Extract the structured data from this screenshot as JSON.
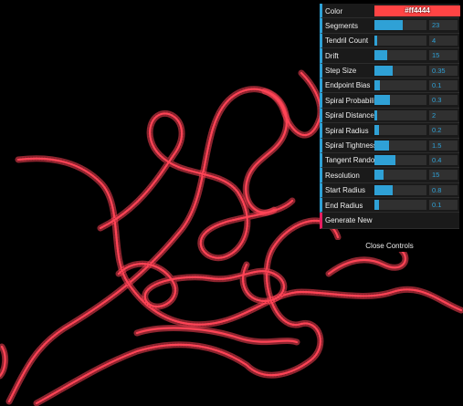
{
  "gui": {
    "color": {
      "label": "Color",
      "value": "#ff4444"
    },
    "sliders": [
      {
        "label": "Segments",
        "value": "23",
        "fill": 0.55
      },
      {
        "label": "Tendril Count",
        "value": "4",
        "fill": 0.06
      },
      {
        "label": "Drift",
        "value": "15",
        "fill": 0.24
      },
      {
        "label": "Step Size",
        "value": "0.35",
        "fill": 0.35
      },
      {
        "label": "Endpoint Bias",
        "value": "0.1",
        "fill": 0.1
      },
      {
        "label": "Spiral Probability",
        "value": "0.3",
        "fill": 0.3
      },
      {
        "label": "Spiral Distance",
        "value": "2",
        "fill": 0.05
      },
      {
        "label": "Spiral Radius",
        "value": "0.2",
        "fill": 0.08
      },
      {
        "label": "Spiral Tightness",
        "value": "1.5",
        "fill": 0.28
      },
      {
        "label": "Tangent Random",
        "value": "0.4",
        "fill": 0.4
      },
      {
        "label": "Resolution",
        "value": "15",
        "fill": 0.18
      },
      {
        "label": "Start Radius",
        "value": "0.8",
        "fill": 0.35
      },
      {
        "label": "End Radius",
        "value": "0.1",
        "fill": 0.08
      }
    ],
    "generate_label": "Generate New",
    "close_label": "Close Controls"
  },
  "colors": {
    "accent": "#2fa1d6",
    "tendril": "#ff4456",
    "button_accent": "#e61d5f"
  }
}
